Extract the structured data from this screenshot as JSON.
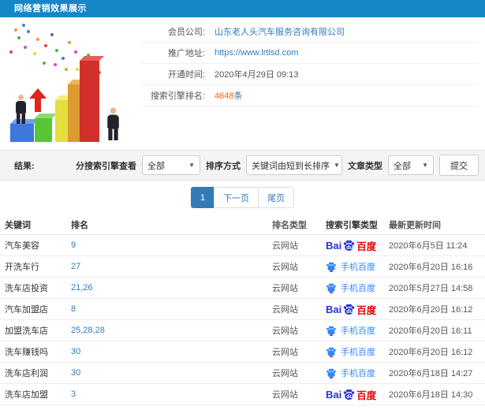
{
  "header": {
    "title": "网络营销效果展示"
  },
  "info": {
    "company_label": "会员公司:",
    "company_value": "山东老人头汽车服务咨询有限公司",
    "url_label": "推广地址:",
    "url_value": "https://www.lrtlsd.com",
    "open_time_label": "开通时间:",
    "open_time_value": "2020年4月29日 09:13",
    "rank_label": "搜索引擎排名:",
    "rank_count": "4648",
    "rank_unit": "条"
  },
  "filters": {
    "result_label": "结果:",
    "engine_filter_label": "分搜索引擎查看",
    "engine_filter_value": "全部",
    "sort_label": "排序方式",
    "sort_value": "关键词由短到长排序",
    "article_type_label": "文章类型",
    "article_type_value": "全部",
    "submit_label": "提交"
  },
  "pagination": {
    "current": "1",
    "next": "下一页",
    "last": "尾页"
  },
  "table": {
    "headers": [
      "关键词",
      "排名",
      "排名类型",
      "搜索引擎类型",
      "最新更新时间"
    ],
    "engines": {
      "baidu_pc": {
        "bai": "Bai",
        "du": "du",
        "text": "百度"
      },
      "baidu_mobile": {
        "text": "手机百度"
      }
    },
    "rows": [
      {
        "keyword": "汽车美容",
        "rank": "9",
        "rank_type": "云网站",
        "engine": "baidu_pc",
        "updated": "2020年6月5日 11:24"
      },
      {
        "keyword": "开洗车行",
        "rank": "27",
        "rank_type": "云网站",
        "engine": "baidu_mobile",
        "updated": "2020年6月20日 16:16"
      },
      {
        "keyword": "洗车店投资",
        "rank": "21,26",
        "rank_type": "云网站",
        "engine": "baidu_mobile",
        "updated": "2020年5月27日 14:58"
      },
      {
        "keyword": "汽车加盟店",
        "rank": "8",
        "rank_type": "云网站",
        "engine": "baidu_pc",
        "updated": "2020年6月20日 16:12"
      },
      {
        "keyword": "加盟洗车店",
        "rank": "25,28,28",
        "rank_type": "云网站",
        "engine": "baidu_mobile",
        "updated": "2020年6月20日 16:11"
      },
      {
        "keyword": "洗车赚钱吗",
        "rank": "30",
        "rank_type": "云网站",
        "engine": "baidu_mobile",
        "updated": "2020年6月20日 16:12"
      },
      {
        "keyword": "洗车店利润",
        "rank": "30",
        "rank_type": "云网站",
        "engine": "baidu_mobile",
        "updated": "2020年6月18日 14:27"
      },
      {
        "keyword": "洗车店加盟",
        "rank": "3",
        "rank_type": "云网站",
        "engine": "baidu_pc",
        "updated": "2020年6月18日 14:30"
      }
    ]
  },
  "colors": {
    "header_bg": "#1587c8",
    "link_blue": "#337ab7",
    "highlight_orange": "#ff6600",
    "baidu_blue": "#2733dc",
    "baidu_red": "#e10602",
    "mobile_baidu_blue": "#3385ff",
    "pagination_active_bg": "#337ab7"
  }
}
